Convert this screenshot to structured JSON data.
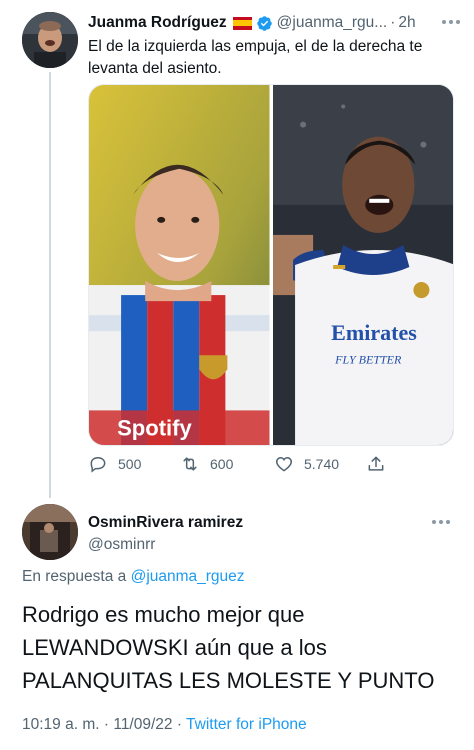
{
  "tweet": {
    "author_name": "Juanma Rodríguez",
    "author_handle": "@juanma_rgu...",
    "separator": "·",
    "time": "2h",
    "text": "El de la izquierda las empuja, el de la derecha te levanta del asiento.",
    "media": {
      "left_image_text": "Spotify",
      "right_image_text_1": "Emirates",
      "right_image_text_2": "FLY BETTER"
    },
    "actions": {
      "replies": "500",
      "retweets": "600",
      "likes": "5.740"
    }
  },
  "reply": {
    "author_name": "OsminRivera ramirez",
    "author_handle": "@osminrr",
    "replying_prefix": "En respuesta a ",
    "replying_handle": "@juanma_rguez",
    "text": "Rodrigo es mucho mejor que LEWANDOWSKI aún que a los PALANQUITAS LES MOLESTE Y PUNTO",
    "time": "10:19 a. m.",
    "date": "11/09/22",
    "separator": "·",
    "source": "Twitter for iPhone"
  },
  "colors": {
    "accent": "#1d9bf0",
    "secondary_text": "#536471",
    "primary_text": "#0f1419"
  },
  "icons": [
    "verified-badge-icon",
    "more-icon",
    "reply-icon",
    "retweet-icon",
    "like-icon",
    "share-icon"
  ]
}
